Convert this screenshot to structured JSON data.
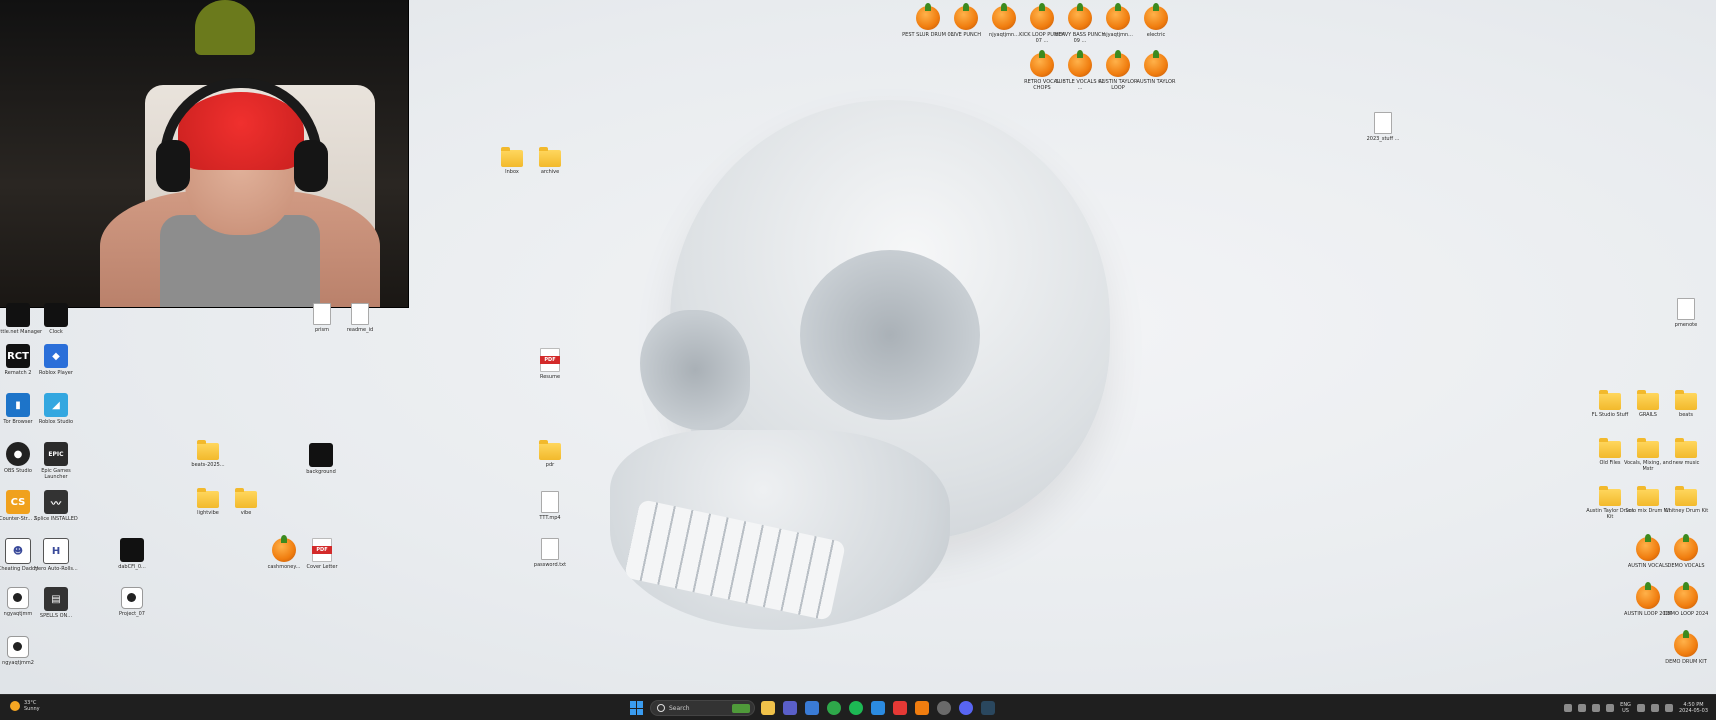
{
  "desktop_icons": [
    {
      "label": "PEST SLUR DRUM 03",
      "glyph": "fl"
    },
    {
      "label": "LIVE PUNCH",
      "glyph": "fl"
    },
    {
      "label": "njyaqtjmn...",
      "glyph": "fl"
    },
    {
      "label": "KICK LOOP PUNCH 07 ...",
      "glyph": "fl"
    },
    {
      "label": "HEAVY BASS PUNCH 09 ...",
      "glyph": "fl"
    },
    {
      "label": "njyaqtjmn...",
      "glyph": "fl"
    },
    {
      "label": "electric",
      "glyph": "fl"
    },
    {
      "label": "RETRO VOCAL CHOPS",
      "glyph": "fl"
    },
    {
      "label": "SUBTLE VOCALS 02 ...",
      "glyph": "fl"
    },
    {
      "label": "AUSTIN TAYLOR LOOP",
      "glyph": "fl"
    },
    {
      "label": "AUSTIN TAYLOR",
      "glyph": "fl"
    },
    {
      "label": "2023_stuff ...",
      "glyph": "doc"
    },
    {
      "label": "Inbox",
      "glyph": "folder"
    },
    {
      "label": "archive",
      "glyph": "folder"
    },
    {
      "label": "Resume",
      "glyph": "pdf"
    },
    {
      "label": "Battle.net Manager",
      "glyph": "black"
    },
    {
      "label": "Clock",
      "glyph": "black"
    },
    {
      "label": "Rematch 2",
      "glyph": "black",
      "text": "RCT"
    },
    {
      "label": "Roblox Player",
      "glyph": "roblox",
      "text": "◆"
    },
    {
      "label": "Tor Browser",
      "glyph": "blue",
      "text": "▮"
    },
    {
      "label": "Roblox Studio",
      "glyph": "cyan",
      "text": "◢"
    },
    {
      "label": "OBS Studio",
      "glyph": "obs",
      "text": "●"
    },
    {
      "label": "Epic Games Launcher",
      "glyph": "epic",
      "text": "EPIC"
    },
    {
      "label": "Counter-Str... 2",
      "glyph": "orange",
      "text": "CS"
    },
    {
      "label": "Splice INSTALLED",
      "glyph": "dark",
      "text": "〰"
    },
    {
      "label": "Cheating Daddy",
      "glyph": "white",
      "text": "☻"
    },
    {
      "label": "Hero Auto-Rolls...",
      "glyph": "white",
      "text": "H"
    },
    {
      "label": "ngyaqtjmm",
      "glyph": "vid"
    },
    {
      "label": "SPELLS ON...",
      "glyph": "dark",
      "text": "▤"
    },
    {
      "label": "ngyaqtjmm2",
      "glyph": "vid"
    },
    {
      "label": "prism",
      "glyph": "doc"
    },
    {
      "label": "readme_id",
      "glyph": "doc"
    },
    {
      "label": "beats-2025...",
      "glyph": "folder"
    },
    {
      "label": "background",
      "glyph": "black"
    },
    {
      "label": "lightvibe",
      "glyph": "folder"
    },
    {
      "label": "vibe",
      "glyph": "folder"
    },
    {
      "label": "cashmoney...",
      "glyph": "fl"
    },
    {
      "label": "Cover Letter",
      "glyph": "pdf"
    },
    {
      "label": "dabCFl_0...",
      "glyph": "black"
    },
    {
      "label": "Project_07",
      "glyph": "vid"
    },
    {
      "label": "pdr",
      "glyph": "folder"
    },
    {
      "label": "TTT.mp4",
      "glyph": "doc"
    },
    {
      "label": "password.txt",
      "glyph": "doc"
    },
    {
      "label": "pmenote",
      "glyph": "doc"
    },
    {
      "label": "FL Studio Stuff",
      "glyph": "folder"
    },
    {
      "label": "GRAILS",
      "glyph": "folder"
    },
    {
      "label": "beats",
      "glyph": "folder"
    },
    {
      "label": "Old Files",
      "glyph": "folder"
    },
    {
      "label": "Vocals, Mixing, and Mstr",
      "glyph": "folder"
    },
    {
      "label": "new music",
      "glyph": "folder"
    },
    {
      "label": "Austin Taylor Drum Kit",
      "glyph": "folder"
    },
    {
      "label": "Solo mix Drum Kit",
      "glyph": "folder"
    },
    {
      "label": "Whitney Drum Kit",
      "glyph": "folder"
    },
    {
      "label": "AUSTIN VOCALS",
      "glyph": "fl"
    },
    {
      "label": "DEMO VOCALS",
      "glyph": "fl"
    },
    {
      "label": "AUSTIN LOOP 2024",
      "glyph": "fl"
    },
    {
      "label": "DEMO LOOP 2024",
      "glyph": "fl"
    },
    {
      "label": "DEMO DRUM KIT",
      "glyph": "fl"
    }
  ],
  "taskbar": {
    "weather_temp": "33°C",
    "weather_cond": "Sunny",
    "search_placeholder": "Search",
    "apps": [
      {
        "name": "file-explorer",
        "color": "#f0c24a"
      },
      {
        "name": "teams",
        "color": "#5a5fc8"
      },
      {
        "name": "store",
        "color": "#3a7bd5"
      },
      {
        "name": "chrome",
        "color": "#2ea84a"
      },
      {
        "name": "spotify",
        "color": "#1db954"
      },
      {
        "name": "edge",
        "color": "#2b8be0"
      },
      {
        "name": "youtube",
        "color": "#e53935"
      },
      {
        "name": "fl-studio",
        "color": "#f07d0f"
      },
      {
        "name": "obs",
        "color": "#6a6a6a"
      },
      {
        "name": "discord",
        "color": "#5865f2"
      },
      {
        "name": "steam",
        "color": "#2a475e"
      }
    ],
    "language": "ENG",
    "locale": "US",
    "time": "4:50 PM",
    "date": "2024-05-03"
  },
  "colors": {
    "taskbar_bg": "#1f1f1f",
    "accent": "#3a9cf0"
  }
}
